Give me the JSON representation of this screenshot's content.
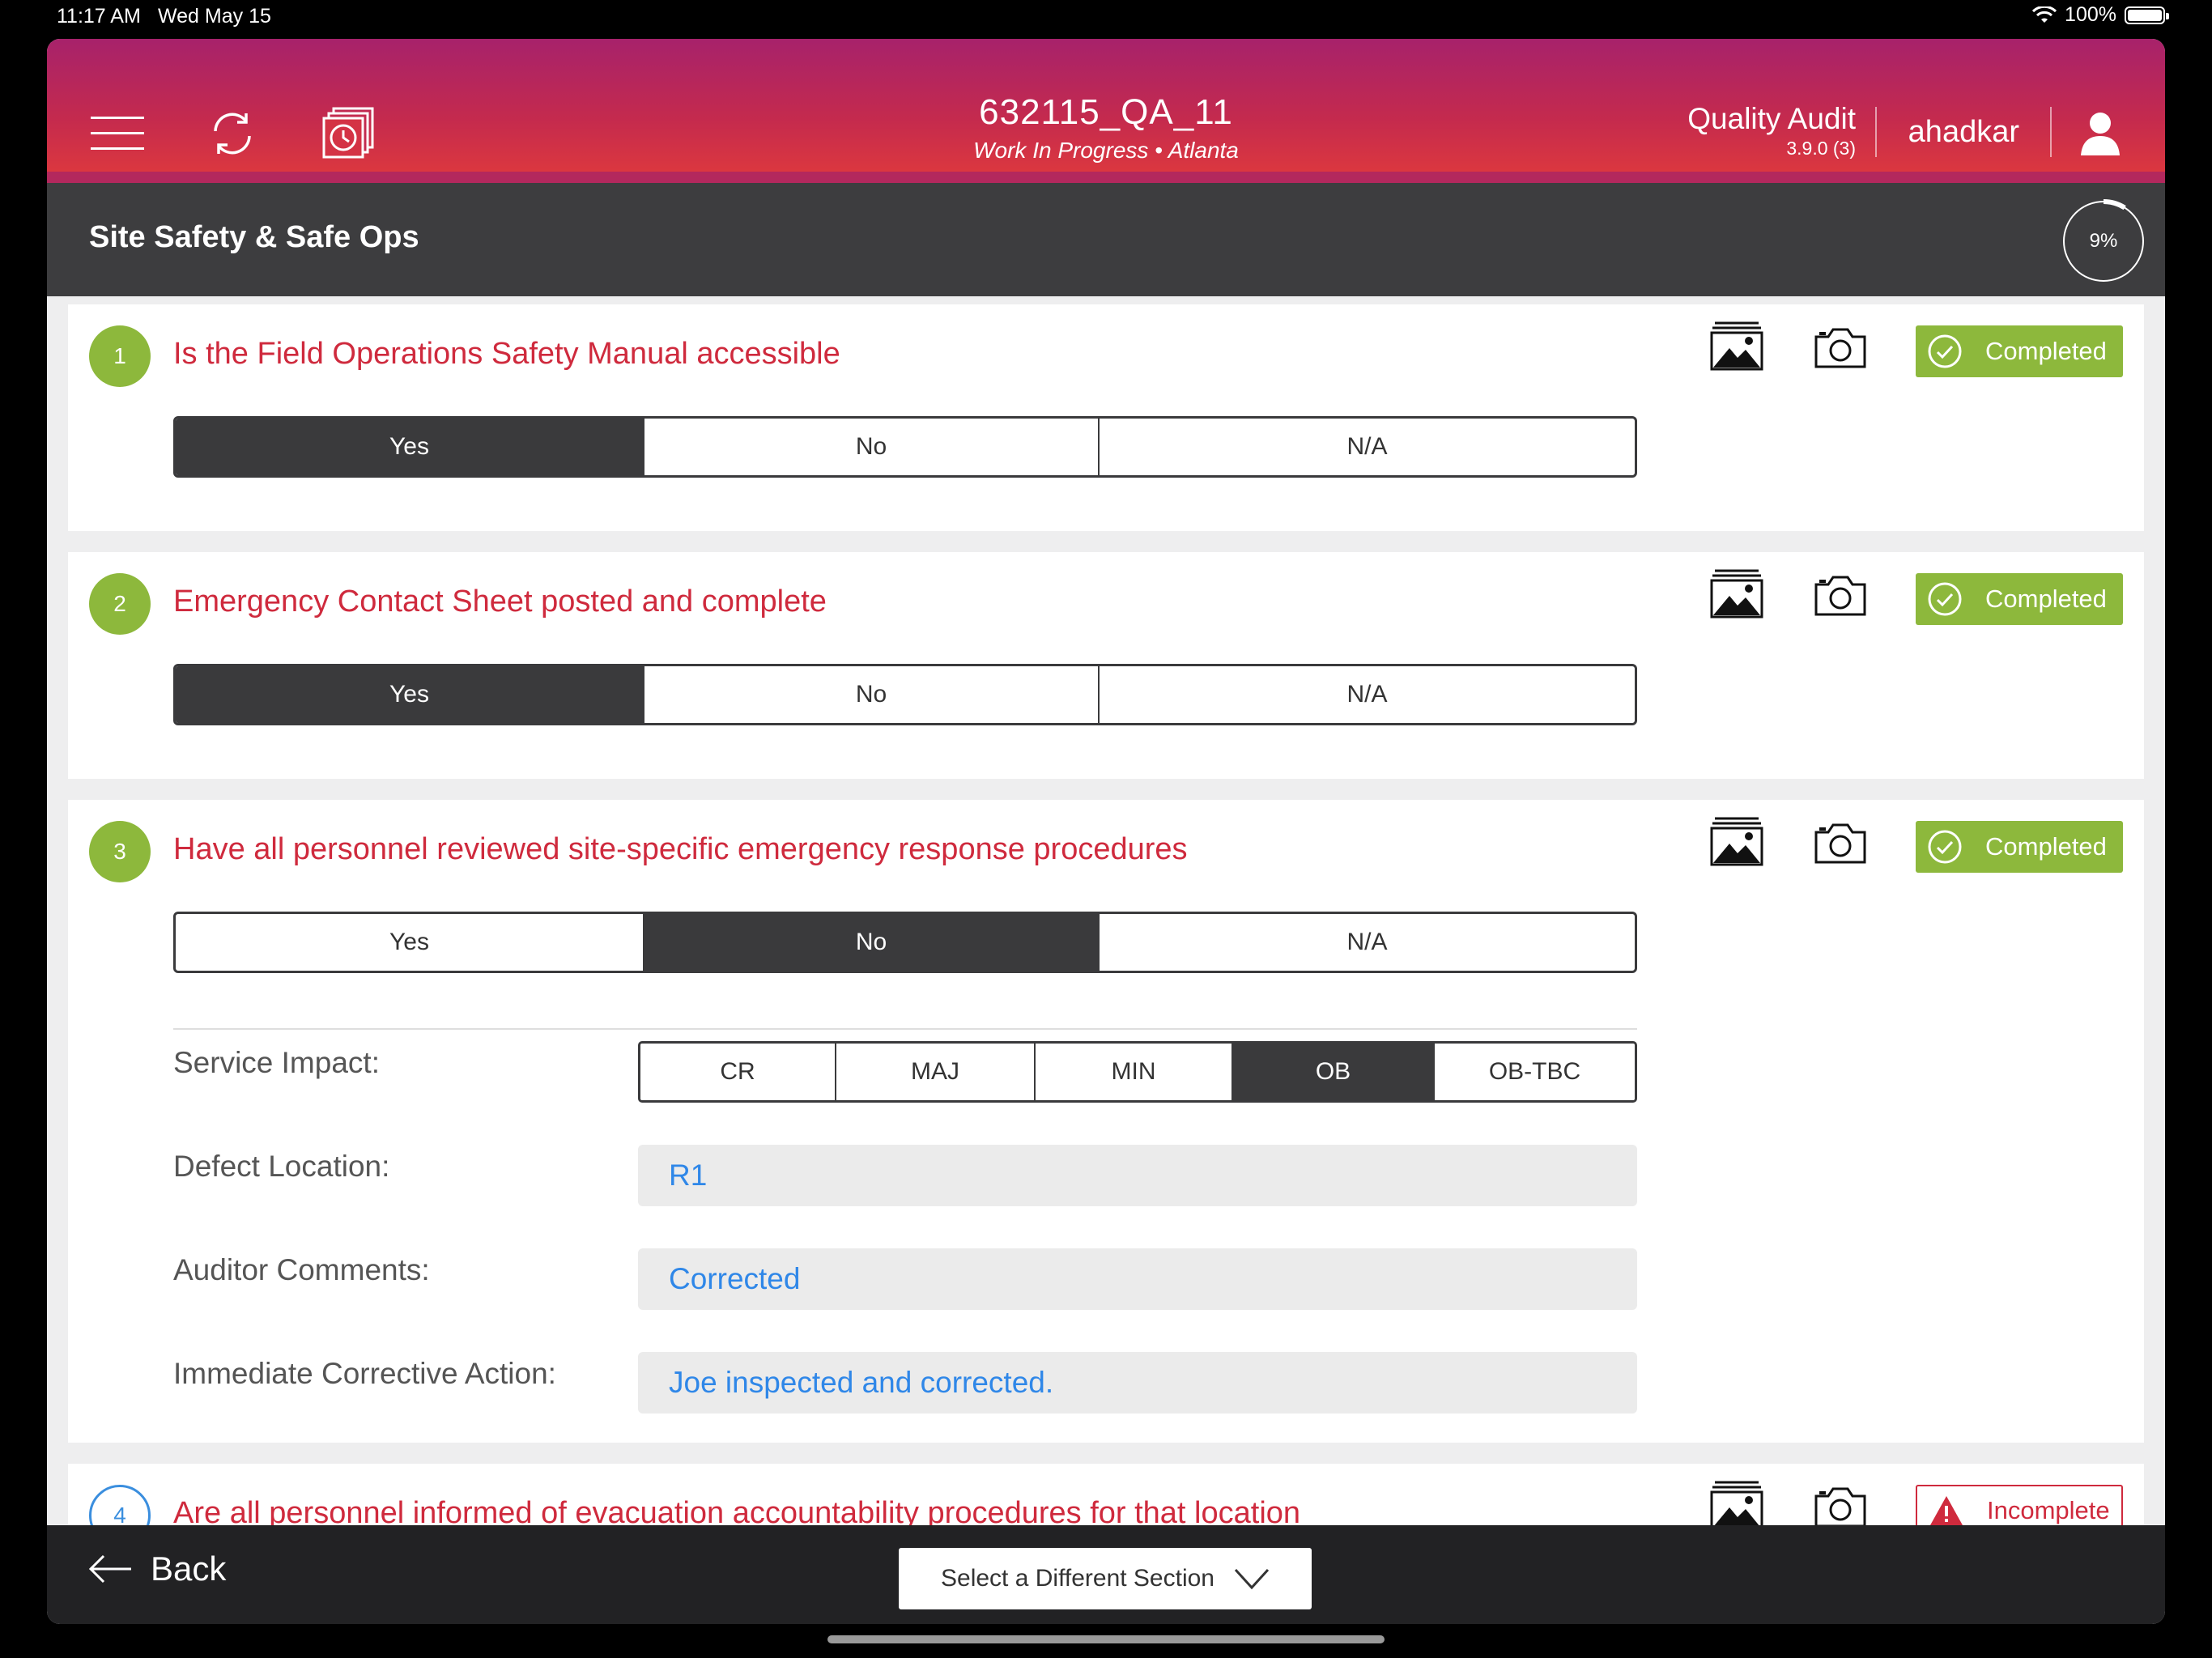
{
  "status_bar": {
    "time": "11:17 AM",
    "date": "Wed May 15",
    "battery": "100%",
    "battery_level": 1.0
  },
  "header": {
    "job_id": "632115_QA_11",
    "job_status": "Work In Progress • Atlanta",
    "app_name": "Quality Audit",
    "app_version": "3.9.0 (3)",
    "username": "ahadkar",
    "icons": [
      "menu-icon",
      "sync-icon",
      "history-icon",
      "user-icon"
    ]
  },
  "section": {
    "title": "Site Safety & Safe Ops",
    "progress_label": "9%",
    "progress": 0.09
  },
  "answer_options": [
    "Yes",
    "No",
    "N/A"
  ],
  "questions": [
    {
      "number": "1",
      "text": "Is the Field Operations Safety Manual accessible",
      "answer": "Yes",
      "status": "Completed"
    },
    {
      "number": "2",
      "text": "Emergency Contact Sheet posted and complete",
      "answer": "Yes",
      "status": "Completed"
    },
    {
      "number": "3",
      "text": "Have all personnel reviewed site-specific emergency response procedures",
      "answer": "No",
      "status": "Completed",
      "details": {
        "service_impact_label": "Service Impact:",
        "service_impact_options": [
          "CR",
          "MAJ",
          "MIN",
          "OB",
          "OB-TBC"
        ],
        "service_impact_selected": "OB",
        "defect_location_label": "Defect Location:",
        "defect_location": "R1",
        "auditor_comments_label": "Auditor Comments:",
        "auditor_comments": "Corrected",
        "corrective_action_label": "Immediate Corrective Action:",
        "corrective_action": "Joe inspected and corrected."
      }
    },
    {
      "number": "4",
      "text": "Are all personnel informed of evacuation accountability procedures for that location",
      "status": "Incomplete"
    }
  ],
  "footer": {
    "back_label": "Back",
    "select_section_label": "Select a Different Section"
  },
  "colors": {
    "header_top": "#a7226b",
    "header_bottom": "#e03a3c",
    "question_text": "#cf2a3d",
    "completed": "#8db83c",
    "input_text": "#2f87e8",
    "selected": "#3a3a3c"
  }
}
